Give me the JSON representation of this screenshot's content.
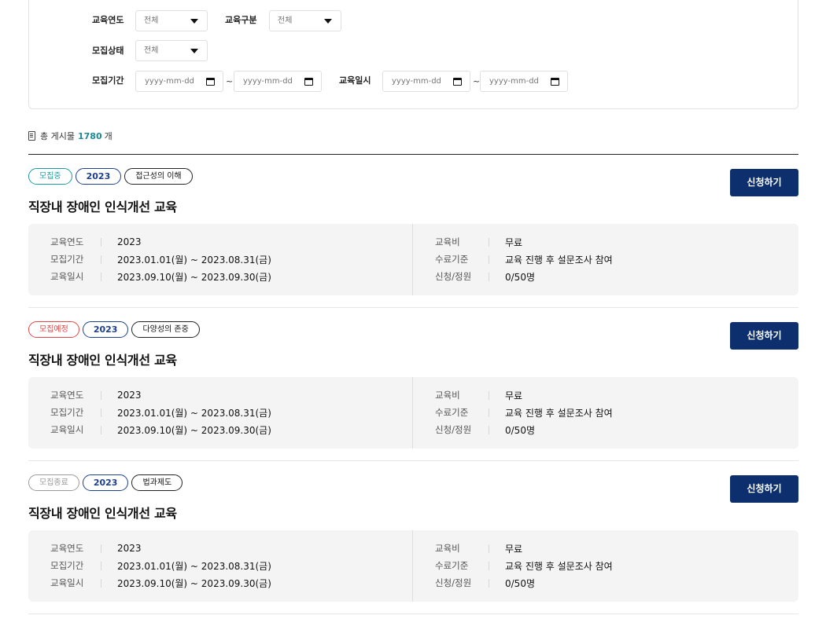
{
  "filters": {
    "edu_year_label": "교육연도",
    "edu_year_value": "전체",
    "edu_type_label": "교육구분",
    "edu_type_value": "전체",
    "recruit_status_label": "모집상태",
    "recruit_status_value": "전체",
    "recruit_period_label": "모집기간",
    "recruit_start_placeholder": "yyyy-mm-dd",
    "recruit_end_placeholder": "yyyy-mm-dd",
    "edu_date_label": "교육일시",
    "edu_start_placeholder": "yyyy-mm-dd",
    "edu_end_placeholder": "yyyy-mm-dd",
    "tilde": "~"
  },
  "summary": {
    "prefix": "총 게시물",
    "count": "1780",
    "suffix": "개"
  },
  "courses": [
    {
      "status": "모집중",
      "status_color": "#1b9aa0",
      "year": "2023",
      "topic": "접근성의 이해",
      "title": "직장내 장애인 인식개선 교육",
      "apply_label": "신청하기",
      "left": [
        {
          "key": "교육연도",
          "value": "2023"
        },
        {
          "key": "모집기간",
          "value": "2023.01.01(월) ~ 2023.08.31(금)"
        },
        {
          "key": "교육일시",
          "value": "2023.09.10(월) ~ 2023.09.30(금)"
        }
      ],
      "right": [
        {
          "key": "교육비",
          "value": "무료"
        },
        {
          "key": "수료기준",
          "value": "교육 진행 후 설문조사 참여"
        },
        {
          "key": "신청/정원",
          "value": "0/50명"
        }
      ]
    },
    {
      "status": "모집예정",
      "status_color": "#e04848",
      "year": "2023",
      "topic": "다양성의 존중",
      "title": "직장내 장애인 인식개선 교육",
      "apply_label": "신청하기",
      "left": [
        {
          "key": "교육연도",
          "value": "2023"
        },
        {
          "key": "모집기간",
          "value": "2023.01.01(월) ~ 2023.08.31(금)"
        },
        {
          "key": "교육일시",
          "value": "2023.09.10(월) ~ 2023.09.30(금)"
        }
      ],
      "right": [
        {
          "key": "교육비",
          "value": "무료"
        },
        {
          "key": "수료기준",
          "value": "교육 진행 후 설문조사 참여"
        },
        {
          "key": "신청/정원",
          "value": "0/50명"
        }
      ]
    },
    {
      "status": "모집종료",
      "status_color": "#9a9a9a",
      "year": "2023",
      "topic": "법과제도",
      "title": "직장내 장애인 인식개선 교육",
      "apply_label": "신청하기",
      "left": [
        {
          "key": "교육연도",
          "value": "2023"
        },
        {
          "key": "모집기간",
          "value": "2023.01.01(월) ~ 2023.08.31(금)"
        },
        {
          "key": "교육일시",
          "value": "2023.09.10(월) ~ 2023.09.30(금)"
        }
      ],
      "right": [
        {
          "key": "교육비",
          "value": "무료"
        },
        {
          "key": "수료기준",
          "value": "교육 진행 후 설문조사 참여"
        },
        {
          "key": "신청/정원",
          "value": "0/50명"
        }
      ]
    }
  ]
}
